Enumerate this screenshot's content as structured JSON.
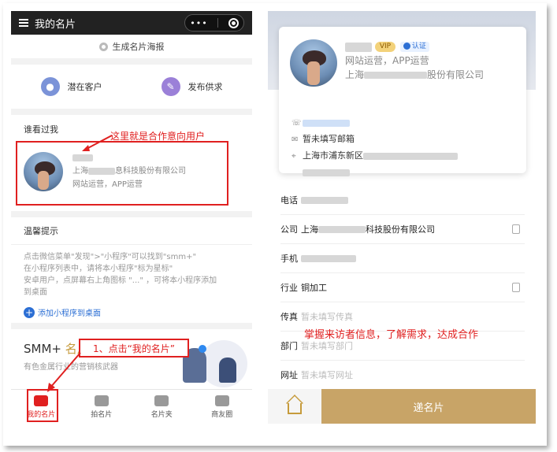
{
  "left": {
    "nav_title": "我的名片",
    "capsule_dots": "•••",
    "poster_label": "生成名片海报",
    "actions": [
      {
        "label": "潜在客户",
        "icon": "people-icon"
      },
      {
        "label": "发布供求",
        "icon": "pencil-icon"
      }
    ],
    "visitors_title": "谁看过我",
    "visitor": {
      "company_prefix": "上海",
      "company_suffix": "息科技股份有限公司",
      "role": "网站运营，APP运营"
    },
    "annotation_visitor": "这里就是合作意向用户",
    "tips_title": "温馨提示",
    "tips_lines": [
      "点击微信菜单\"发现\">\"小程序\"可以找到\"smm+\"",
      "在小程序列表中，请将本小程序\"标为星标\"",
      "安卓用户，点屏幕右上角图标 \"...\" ，可将本小程序添加",
      "到桌面"
    ],
    "tips_link": "添加小程序到桌面",
    "smm_title_a": "SMM+",
    "smm_title_b": "名片",
    "smm_sub": "有色金属行业的营销核武器",
    "annotation_step": "1、点击“我的名片”",
    "tabs": [
      {
        "label": "我的名片",
        "icon": "card-icon",
        "active": true
      },
      {
        "label": "拍名片",
        "icon": "camera-icon",
        "active": false
      },
      {
        "label": "名片夹",
        "icon": "folder-icon",
        "active": false
      },
      {
        "label": "商友圈",
        "icon": "friends-icon",
        "active": false
      }
    ]
  },
  "right": {
    "badge_vip": "VIP",
    "badge_verified": "认证",
    "role": "网站运营，APP运营",
    "company_prefix": "上海",
    "company_suffix": "股份有限公司",
    "email": "暂未填写邮箱",
    "address": "上海市浦东新区",
    "rows": [
      {
        "label": "电话",
        "value": "",
        "placeholder": false,
        "copy": false
      },
      {
        "label": "公司",
        "value_prefix": "上海",
        "value": "科技股份有限公司",
        "placeholder": false,
        "copy": true
      },
      {
        "label": "手机",
        "value": "",
        "placeholder": false,
        "copy": false
      },
      {
        "label": "行业",
        "value": "铜加工",
        "placeholder": false,
        "copy": true
      },
      {
        "label": "传真",
        "value": "暂未填写传真",
        "placeholder": true,
        "copy": false
      },
      {
        "label": "部门",
        "value": "暂未填写部门",
        "placeholder": true,
        "copy": false
      },
      {
        "label": "网址",
        "value": "暂未填写网址",
        "placeholder": true,
        "copy": false
      }
    ],
    "annotation": "掌握来访者信息，了解需求，达成合作",
    "send_label": "递名片"
  },
  "colors": {
    "annotation_red": "#e02020",
    "gold": "#c8a467",
    "link_blue": "#2c6fd4"
  }
}
